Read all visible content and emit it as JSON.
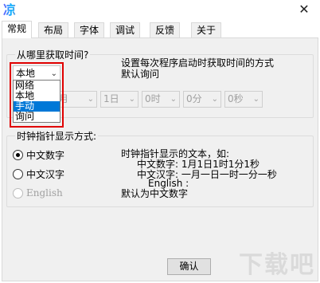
{
  "window": {
    "icon_glyph": "凉",
    "close_glyph": "✕"
  },
  "tabs": [
    {
      "label": "常规"
    },
    {
      "label": "布局"
    },
    {
      "label": "字体"
    },
    {
      "label": "调试"
    },
    {
      "label": "反馈"
    },
    {
      "label": "关于"
    }
  ],
  "time_source": {
    "group_title": "从哪里获取时间?",
    "selected": "本地",
    "options": [
      "网络",
      "本地",
      "手动",
      "询问"
    ],
    "highlighted_option": "手动",
    "hint_line1": "设置每次程序启动时获取时间的方式",
    "hint_line2": "默认询问",
    "manual_fields": [
      "月",
      "1日",
      "0时",
      "0分",
      "0秒"
    ]
  },
  "pointer": {
    "group_title": "时钟指针显示方式:",
    "options": [
      {
        "label": "中文数字",
        "checked": true,
        "disabled": false
      },
      {
        "label": "中文汉字",
        "checked": false,
        "disabled": false
      },
      {
        "label": "English",
        "checked": false,
        "disabled": true
      }
    ],
    "desc_title": "时钟指针显示的文本，如:",
    "desc_line1": "中文数字: 1月1日1时1分1秒",
    "desc_line2": "中文汉字: 一月一日一时一分一秒",
    "desc_line3": "English :",
    "desc_default": "默认为中文数字"
  },
  "buttons": {
    "ok": "确认"
  },
  "watermark": "下载吧"
}
